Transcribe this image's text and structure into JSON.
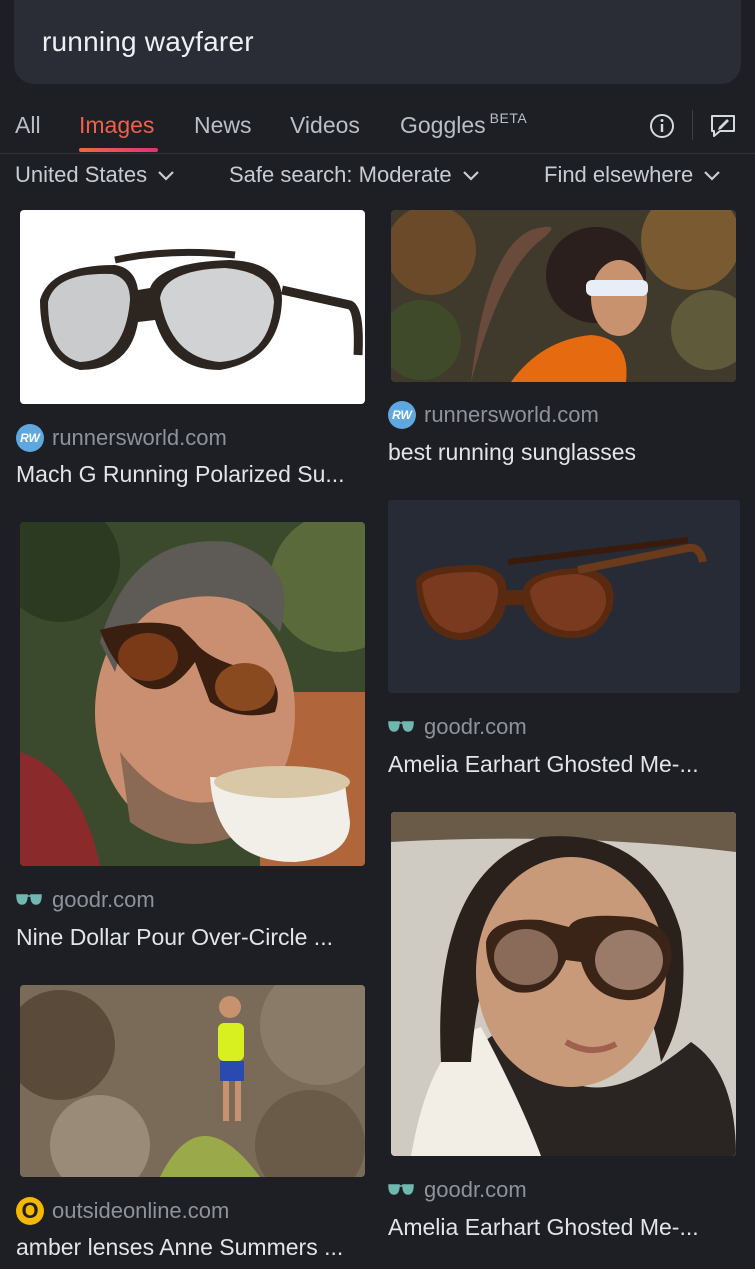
{
  "search": {
    "query": "running wayfarer"
  },
  "tabs": [
    {
      "label": "All"
    },
    {
      "label": "Images"
    },
    {
      "label": "News"
    },
    {
      "label": "Videos"
    },
    {
      "label": "Goggles",
      "badge": "BETA"
    }
  ],
  "filters": {
    "region": "United States",
    "safe_search": "Safe search: Moderate",
    "find_elsewhere": "Find elsewhere"
  },
  "results": [
    {
      "source": "runnersworld.com",
      "title": "Mach G Running Polarized Su...",
      "favicon": "runnersworld-icon"
    },
    {
      "source": "runnersworld.com",
      "title": "best running sunglasses",
      "favicon": "runnersworld-icon"
    },
    {
      "source": "goodr.com",
      "title": "Nine Dollar Pour Over-Circle ...",
      "favicon": "goodr-icon"
    },
    {
      "source": "goodr.com",
      "title": "Amelia Earhart Ghosted Me-...",
      "favicon": "goodr-icon"
    },
    {
      "source": "outsideonline.com",
      "title": "amber lenses Anne Summers ...",
      "favicon": "outside-icon"
    },
    {
      "source": "goodr.com",
      "title": "Amelia Earhart Ghosted Me-...",
      "favicon": "goodr-icon"
    }
  ],
  "colors": {
    "accent": "#f0604a",
    "background": "#1d1f24",
    "surface": "#2a2d35"
  }
}
